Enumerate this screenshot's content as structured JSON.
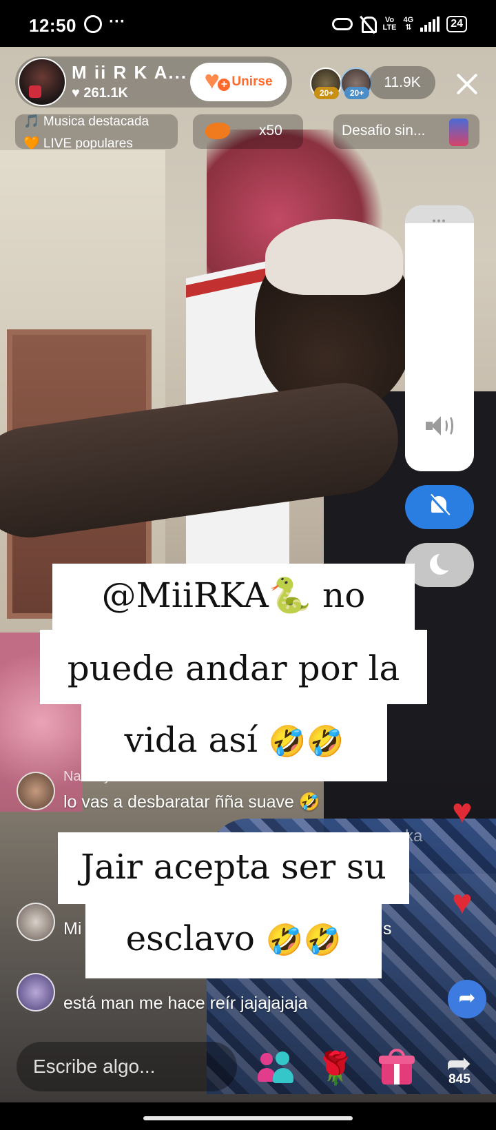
{
  "status_bar": {
    "time": "12:50",
    "left_more": "···",
    "network_top": "Vo",
    "network_bottom": "LTE",
    "network_type": "4G",
    "battery": "24",
    "icons": [
      "whatsapp-icon",
      "link-icon",
      "bell-off-icon",
      "signal-icon",
      "battery-icon"
    ]
  },
  "host": {
    "name": "M ii R K A...",
    "likes": "♥ 261.1K",
    "join_label": "Unirse"
  },
  "viewers": {
    "badges": [
      "20+",
      "20+"
    ],
    "count": "11.9K"
  },
  "featured": {
    "line1": "🎵 Musica destacada",
    "line2": "🧡 LIVE populares"
  },
  "gift_goal": {
    "count": "x50"
  },
  "challenge": {
    "label": "Desafio sin..."
  },
  "volume_panel": {
    "handle": "•••"
  },
  "captions": {
    "line1": "@MiiRKA🐍  no",
    "line2": "puede andar por la",
    "line3_text": "vida así ",
    "line3_emoji": "🤣🤣",
    "line4": "Jair acepta ser su",
    "line5_text": "esclavo ",
    "line5_emoji": "🤣🤣"
  },
  "comments": [
    {
      "user": "Nandeya",
      "text": "lo vas a desbaratar ññа suave 🤣"
    },
    {
      "user": "",
      "text": "Mi"
    },
    {
      "user": "",
      "text": "está man me hace reír jajajajaja"
    }
  ],
  "faded_fragment": "ka",
  "faded_fragment_2": "s",
  "bottom_bar": {
    "input_placeholder": "Escribe algo...",
    "share_count": "845",
    "icons": [
      "multi-guest-icon",
      "rose-icon",
      "gift-icon",
      "share-icon"
    ]
  },
  "colors": {
    "join_accent": "#ff6a2c",
    "dnd_blue": "#2a7de1",
    "heart_red": "#e02a36",
    "gift_pink": "#e33c7b"
  }
}
